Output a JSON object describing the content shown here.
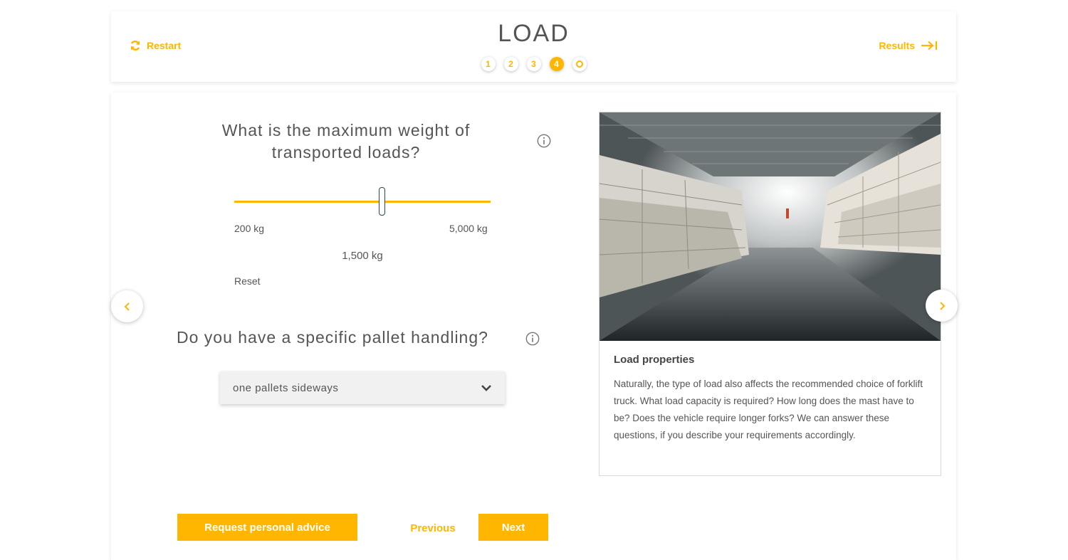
{
  "header": {
    "restart_label": "Restart",
    "title": "LOAD",
    "results_label": "Results",
    "steps": [
      {
        "label": "1",
        "state": "done"
      },
      {
        "label": "2",
        "state": "done"
      },
      {
        "label": "3",
        "state": "done"
      },
      {
        "label": "4",
        "state": "active"
      },
      {
        "label": "",
        "state": "final"
      }
    ]
  },
  "weight_question": {
    "text": "What is the maximum weight of transported loads?",
    "slider": {
      "min_label": "200 kg",
      "max_label": "5,000 kg",
      "min": 200,
      "max": 5000,
      "value": 1500,
      "value_label": "1,500 kg"
    },
    "reset_label": "Reset"
  },
  "pallet_question": {
    "text": "Do you have a specific pallet handling?",
    "selected_option": "one pallets sideways"
  },
  "info_panel": {
    "heading": "Load properties",
    "body": "Naturally, the type of load also affects the recommended choice of forklift truck. What load capacity is required? How long does the mast have to be? Does the vehicle require longer forks? We can answer these questions, if you describe your requirements accordingly."
  },
  "footer": {
    "advice_label": "Request personal advice",
    "previous_label": "Previous",
    "next_label": "Next"
  },
  "colors": {
    "accent": "#ffb600",
    "text": "#555555"
  },
  "icons": {
    "restart": "refresh-icon",
    "results": "arrow-to-end-icon",
    "info": "info-circle-icon",
    "dropdown": "chevron-down-icon",
    "prev": "chevron-left-icon",
    "next": "chevron-right-icon"
  }
}
